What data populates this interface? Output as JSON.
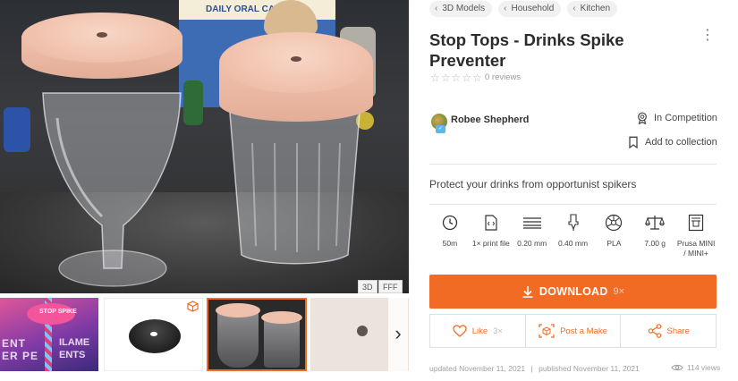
{
  "breadcrumbs": [
    {
      "label": "3D Models"
    },
    {
      "label": "Household"
    },
    {
      "label": "Kitchen"
    }
  ],
  "title": "Stop Tops - Drinks Spike Preventer",
  "rating": {
    "stars_filled": 0,
    "stars_total": 5,
    "reviews_label": "0 reviews"
  },
  "author": {
    "name": "Robee Shepherd"
  },
  "competition_label": "In Competition",
  "collection_label": "Add to collection",
  "summary": "Protect your drinks from opportunist spikers",
  "specs": [
    {
      "icon": "clock-icon",
      "value": "50m"
    },
    {
      "icon": "file-icon",
      "value": "1× print file"
    },
    {
      "icon": "layer-height-icon",
      "value": "0.20 mm"
    },
    {
      "icon": "nozzle-icon",
      "value": "0.40 mm"
    },
    {
      "icon": "filament-spool-icon",
      "value": "PLA"
    },
    {
      "icon": "scale-icon",
      "value": "7.00 g"
    },
    {
      "icon": "printer-icon",
      "value": "Prusa MINI / MINI+"
    }
  ],
  "download": {
    "label": "DOWNLOAD",
    "count": "9×"
  },
  "actions": {
    "like_label": "Like",
    "like_count": "3×",
    "make_label": "Post a Make",
    "share_label": "Share"
  },
  "meta": {
    "updated": "updated November 11, 2021",
    "separator": "|",
    "published": "published November 11, 2021",
    "views": "114 views"
  },
  "image_badges": {
    "three_d": "3D",
    "fff": "FFF"
  },
  "main_image_text": {
    "box_label": "DAILY ORAL CARE"
  },
  "thumbnail_text": {
    "lid": "STOP SPIKE",
    "line1": "ENT",
    "line2": "ER PE",
    "line3": "ILAME",
    "line4": "ENTS"
  },
  "colors": {
    "accent": "#f26b25",
    "cap_pink": "#efbfa9"
  }
}
